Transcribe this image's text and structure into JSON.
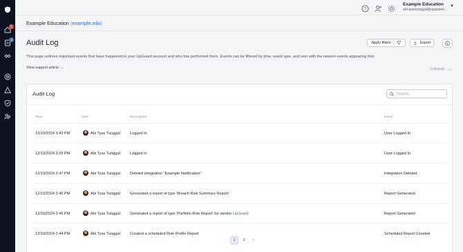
{
  "org": {
    "name": "Example Education",
    "domain": "example.edu"
  },
  "account": {
    "name": "Example Education",
    "email": "abi.tyastunggal@upguard...."
  },
  "rail": {
    "badges": [
      {
        "count": "7",
        "color": "#e5484d"
      },
      {
        "count": "3",
        "color": "#2f6fde"
      }
    ]
  },
  "page": {
    "title": "Audit Log",
    "description": "This page outlines important events that have happened in your UpGuard account and who has performed them. Events can be filtered by time, event type, and user with the newest events appearing first.",
    "support_link": "View support article  →",
    "collapse_label": "Collapse",
    "apply_filters": "Apply filters",
    "export": "Export"
  },
  "card": {
    "title": "Audit Log",
    "search_placeholder": "Search...",
    "columns": {
      "time": "Time",
      "user": "User",
      "description": "Description",
      "event": "Event"
    },
    "rows": [
      {
        "time": "12/19/2024 3:43 PM",
        "user": "Abi Tyas Tunggal",
        "description": "Logged in",
        "event": "User Logged In"
      },
      {
        "time": "12/19/2024 3:29 PM",
        "user": "Abi Tyas Tunggal",
        "description": "Logged in",
        "event": "User Logged In"
      },
      {
        "time": "12/19/2024 2:47 PM",
        "user": "Abi Tyas Tunggal",
        "description": "Deleted integration \"Example Notification\"",
        "event": "Integration Deleted"
      },
      {
        "time": "12/19/2024 2:46 PM",
        "user": "Abi Tyas Tunggal",
        "description": "Generated a report of type 'Breach Risk Summary Report'",
        "event": "Report Generated"
      },
      {
        "time": "12/19/2024 2:45 PM",
        "user": "Abi Tyas Tunggal",
        "description": "Generated a report of type 'Portfolio Risk Report' for vendor ",
        "description_link": "UpGuard",
        "event": "Report Generated"
      },
      {
        "time": "12/19/2024 2:44 PM",
        "user": "Abi Tyas Tunggal",
        "description": "Created a scheduled Risk Profile Report",
        "event": "Scheduled Report Created"
      }
    ]
  },
  "pagination": {
    "pages": [
      "1",
      "2"
    ],
    "current": "1"
  }
}
